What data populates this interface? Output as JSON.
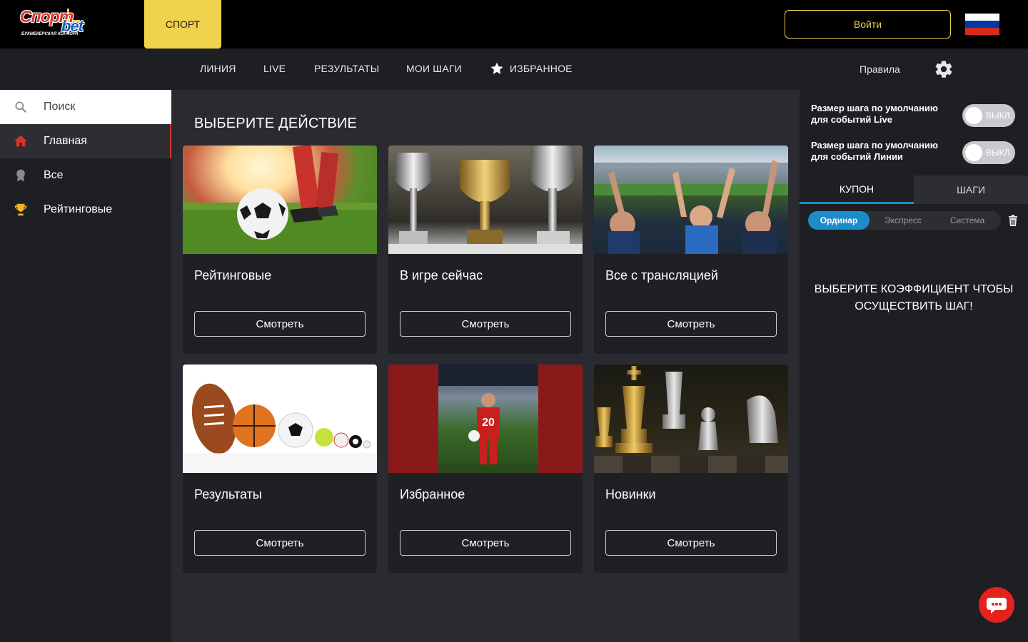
{
  "brand": {
    "logo_main": "Спорт",
    "logo_bet": "bet",
    "logo_sub": "БУКМЕКЕРСКАЯ КОНТОРА"
  },
  "header": {
    "sport_tab": "СПОРТ",
    "login": "Войти",
    "flag_colors": [
      "#ffffff",
      "#0039a6",
      "#d52b1e"
    ]
  },
  "nav": {
    "items": [
      "ЛИНИЯ",
      "LIVE",
      "РЕЗУЛЬТАТЫ",
      "МОИ ШАГИ"
    ],
    "favorites": "ИЗБРАННОЕ",
    "rules": "Правила"
  },
  "sidebar": {
    "search": "Поиск",
    "items": [
      {
        "label": "Главная",
        "icon": "home-icon"
      },
      {
        "label": "Все",
        "icon": "badge-icon"
      },
      {
        "label": "Рейтинговые",
        "icon": "trophy-icon"
      }
    ]
  },
  "main": {
    "title": "ВЫБЕРИТЕ ДЕЙСТВИЕ",
    "cards": [
      {
        "title": "Рейтинговые",
        "button": "Смотреть",
        "image": "soccer-ball-image"
      },
      {
        "title": "В игре сейчас",
        "button": "Смотреть",
        "image": "trophies-image"
      },
      {
        "title": "Все с трансляцией",
        "button": "Смотреть",
        "image": "stadium-fans-image"
      },
      {
        "title": "Результаты",
        "button": "Смотреть",
        "image": "sport-balls-image"
      },
      {
        "title": "Избранное",
        "button": "Смотреть",
        "image": "football-player-image"
      },
      {
        "title": "Новинки",
        "button": "Смотреть",
        "image": "chess-image"
      }
    ]
  },
  "right_panel": {
    "toggles": [
      {
        "label": "Размер шага по умолчанию для событий Live",
        "state": "ВЫКЛ."
      },
      {
        "label": "Размер шага по умолчанию для событий Линии",
        "state": "ВЫКЛ."
      }
    ],
    "tabs": [
      "КУПОН",
      "ШАГИ"
    ],
    "segments": [
      "Ординар",
      "Экспресс",
      "Система"
    ],
    "empty_message": "ВЫБЕРИТЕ КОЭФФИЦИЕНТ ЧТОБЫ ОСУЩЕСТВИТЬ ШАГ!"
  },
  "colors": {
    "accent_yellow": "#f0d24d",
    "accent_blue": "#1c8dc9",
    "accent_red": "#e3231c"
  }
}
